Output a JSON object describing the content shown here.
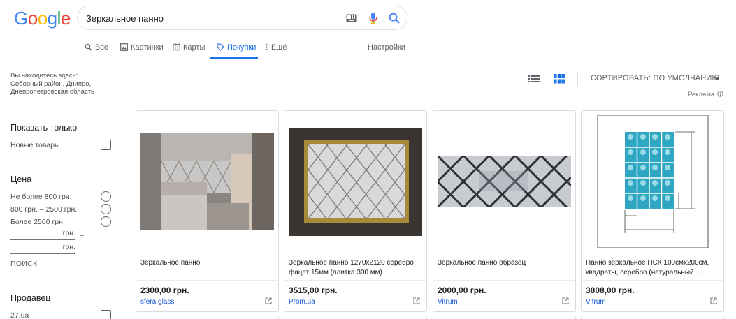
{
  "header": {
    "logo_letters": [
      "G",
      "o",
      "o",
      "g",
      "l",
      "e"
    ],
    "logo_colors": [
      "#4285F4",
      "#EA4335",
      "#FBBC05",
      "#4285F4",
      "#34A853",
      "#EA4335"
    ],
    "search_query": "Зеркальное панно"
  },
  "tabs": [
    {
      "label": "Все",
      "icon": "search-icon"
    },
    {
      "label": "Картинки",
      "icon": "image-icon"
    },
    {
      "label": "Карты",
      "icon": "map-icon"
    },
    {
      "label": "Покупки",
      "icon": "tag-icon",
      "active": true
    },
    {
      "label": "Ещё",
      "icon": "more-vert-icon"
    }
  ],
  "settings_label": "Настройки",
  "location": {
    "line1": "Вы находитесь здесь:",
    "line2": "Соборный район, Днипро,",
    "line3": "Днепропетровская область"
  },
  "toolbar": {
    "sort_label": "СОРТИРОВАТЬ: ПО УМОЛЧАНИЮ",
    "ads_label": "Реклама",
    "view_mode": "grid"
  },
  "filters": {
    "show_only": {
      "heading": "Показать только",
      "new_items": "Новые товары"
    },
    "price": {
      "heading": "Цена",
      "options": [
        "Не более 800 грн.",
        "800 грн. – 2500 грн.",
        "Более 2500 грн."
      ],
      "currency": "грн.",
      "dash": "–",
      "search_button": "ПОИСК"
    },
    "seller": {
      "heading": "Продавец",
      "first": "27.ua"
    }
  },
  "products": [
    {
      "title": "Зеркальное панно",
      "price": "2300,00 грн.",
      "merchant": "sfera glass"
    },
    {
      "title": "Зеркальное панно 1270х2120 серебро фацет 15мм (плитка 300 мм)",
      "price": "3515,00 грн.",
      "merchant": "Prom.ua"
    },
    {
      "title": "Зеркальное панно образец",
      "price": "2000,00 грн.",
      "merchant": "Vitrum"
    },
    {
      "title": "Панно зеркальное НСК 100смх200см, квадраты, серебро (натуральный ...",
      "price": "3808,00 грн.",
      "merchant": "Vitrum"
    }
  ],
  "colors": {
    "accent": "#1a73e8",
    "link": "#1558d6",
    "text": "#202124",
    "muted": "#5f6368"
  }
}
